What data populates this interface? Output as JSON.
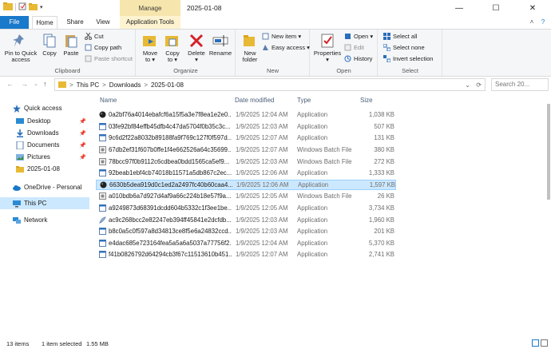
{
  "window": {
    "title": "2025-01-08",
    "contextual_group": "Manage",
    "controls": {
      "minimize": "—",
      "maximize": "☐",
      "close": "✕"
    }
  },
  "tabs": {
    "file": "File",
    "home": "Home",
    "share": "Share",
    "view": "View",
    "tools": "Application Tools"
  },
  "ribbon": {
    "clipboard": {
      "label": "Clipboard",
      "pin_line1": "Pin to Quick",
      "pin_line2": "access",
      "copy": "Copy",
      "paste": "Paste",
      "cut": "Cut",
      "copy_path": "Copy path",
      "paste_shortcut": "Paste shortcut"
    },
    "organize": {
      "label": "Organize",
      "move_to_line1": "Move",
      "move_to_line2": "to ▾",
      "copy_to_line1": "Copy",
      "copy_to_line2": "to ▾",
      "delete_line1": "Delete",
      "delete_line2": "▾",
      "rename": "Rename"
    },
    "new": {
      "label": "New",
      "new_folder_line1": "New",
      "new_folder_line2": "folder",
      "new_item": "New item ▾",
      "easy_access": "Easy access ▾"
    },
    "open": {
      "label": "Open",
      "properties_line1": "Properties",
      "properties_line2": "▾",
      "open": "Open ▾",
      "edit": "Edit",
      "history": "History"
    },
    "select": {
      "label": "Select",
      "select_all": "Select all",
      "select_none": "Select none",
      "invert_selection": "Invert selection"
    },
    "collapse_glyph": "˄",
    "help_glyph": "?"
  },
  "address": {
    "back": "←",
    "forward": "→",
    "recent": "⌄",
    "up": "↑",
    "crumbs": [
      "This PC",
      "Downloads",
      "2025-01-08"
    ],
    "sep": ">",
    "dropdown": "⌄",
    "refresh": "⟳",
    "search_placeholder": "Search 20..."
  },
  "nav": {
    "quick_access": "Quick access",
    "desktop": "Desktop",
    "downloads": "Downloads",
    "documents": "Documents",
    "pictures": "Pictures",
    "folder_2025": "2025-01-08",
    "onedrive": "OneDrive - Personal",
    "this_pc": "This PC",
    "network": "Network",
    "pin_glyph": "📌"
  },
  "columns": {
    "name": "Name",
    "date": "Date modified",
    "type": "Type",
    "size": "Size"
  },
  "files": [
    {
      "name": "0a2bf76a4014ebafcf6a15f5a3e7f8ea1e2e0...",
      "date": "1/9/2025 12:04 AM",
      "type": "Application",
      "size": "1,038 KB",
      "icon": "black-circle-icon"
    },
    {
      "name": "03fe92bf84effb45dfb4c47da5704f0b35c3c...",
      "date": "1/9/2025 12:03 AM",
      "type": "Application",
      "size": "507 KB",
      "icon": "app-icon"
    },
    {
      "name": "9c6d2f22a8032b89188fa9f769c127f0f597d...",
      "date": "1/9/2025 12:07 AM",
      "type": "Application",
      "size": "131 KB",
      "icon": "app-icon"
    },
    {
      "name": "67db2ef31f607b0ffe1f4e662526a64c35699...",
      "date": "1/9/2025 12:07 AM",
      "type": "Windows Batch File",
      "size": "380 KB",
      "icon": "batch-icon"
    },
    {
      "name": "78bcc97f0b9112c6cdbea0bdd1565ca5ef9...",
      "date": "1/9/2025 12:03 AM",
      "type": "Windows Batch File",
      "size": "272 KB",
      "icon": "batch-icon"
    },
    {
      "name": "92beab1ebf4cb74018b11571a5db867c2ec...",
      "date": "1/9/2025 12:06 AM",
      "type": "Application",
      "size": "1,333 KB",
      "icon": "app-icon"
    },
    {
      "name": "6630b5dea919d0c1ed2a2497fc40b60caa4...",
      "date": "1/9/2025 12:06 AM",
      "type": "Application",
      "size": "1,597 KB",
      "icon": "black-circle-icon",
      "selected": true
    },
    {
      "name": "a010bdb6a7d927d4af9a66c224b18e57f9a...",
      "date": "1/9/2025 12:05 AM",
      "type": "Windows Batch File",
      "size": "26 KB",
      "icon": "batch-icon"
    },
    {
      "name": "a9249873d68391dcdd604b5332c1f3ee1be...",
      "date": "1/9/2025 12:05 AM",
      "type": "Application",
      "size": "3,734 KB",
      "icon": "app-icon"
    },
    {
      "name": "ac9c268bcc2e82247eb394ff45841e2dcfdb...",
      "date": "1/9/2025 12:03 AM",
      "type": "Application",
      "size": "1,960 KB",
      "icon": "feather-icon"
    },
    {
      "name": "b8c0a5c0f597a8d34813ce8f5e6a24832ccd...",
      "date": "1/9/2025 12:03 AM",
      "type": "Application",
      "size": "201 KB",
      "icon": "app-icon"
    },
    {
      "name": "e4dac685e723164fea5a5a6a5037a77756f2...",
      "date": "1/9/2025 12:04 AM",
      "type": "Application",
      "size": "5,370 KB",
      "icon": "app-icon"
    },
    {
      "name": "f41b0826792d64294cb3f67c11513610b451...",
      "date": "1/9/2025 12:07 AM",
      "type": "Application",
      "size": "2,741 KB",
      "icon": "app-icon"
    }
  ],
  "status": {
    "items": "13 items",
    "selected": "1 item selected",
    "size": "1.55 MB"
  },
  "colors": {
    "accent": "#1979ca",
    "selection": "#cce8ff",
    "manage": "#f6e6ae"
  }
}
